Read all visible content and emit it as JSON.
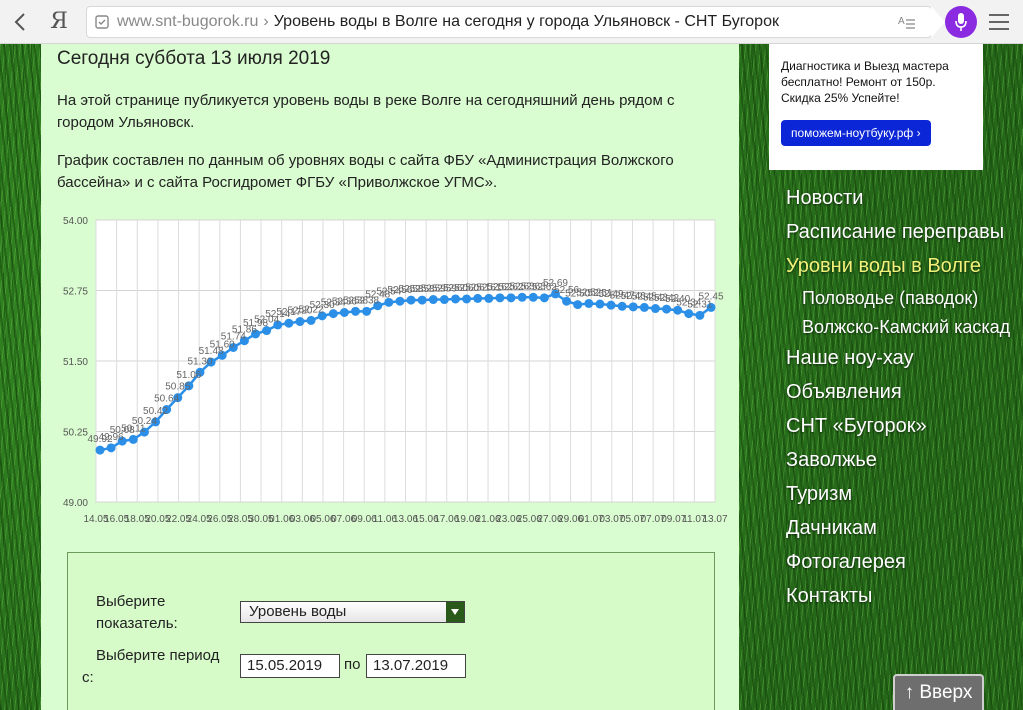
{
  "browser": {
    "domain": "www.snt-bugorok.ru",
    "separator": "›",
    "page_title": "Уровень воды в Волге на сегодня у города Ульяновск - СНТ Бугорок",
    "logo": "Я"
  },
  "main": {
    "date_heading": "Сегодня суббота 13 июля 2019",
    "paragraph1": "На этой странице публикуется уровень воды в реке Волге на сегодняшний день рядом с городом Ульяновск.",
    "paragraph2": "График составлен по данным об уровнях воды с сайта ФБУ «Администрация Волжского бассейна» и с сайта Росгидромет ФГБУ «Приволжское УГМС»."
  },
  "chart_data": {
    "type": "line",
    "title": "",
    "xlabel": "",
    "ylabel": "",
    "ylim": [
      49.0,
      54.0
    ],
    "y_ticks": [
      "49.00",
      "50.25",
      "51.50",
      "52.75",
      "54.00"
    ],
    "x_tick_labels": [
      "14.05",
      "16.05",
      "18.05",
      "20.05",
      "22.05",
      "24.05",
      "26.05",
      "28.05",
      "30.05",
      "01.06",
      "03.06",
      "05.06",
      "07.06",
      "09.06",
      "11.06",
      "13.06",
      "15.06",
      "17.06",
      "19.06",
      "21.06",
      "23.06",
      "25.06",
      "27.06",
      "29.06",
      "01.07",
      "03.07",
      "05.07",
      "07.07",
      "09.07",
      "11.07",
      "13.07"
    ],
    "series_color": "#2b8fe8",
    "grid": true,
    "series": [
      {
        "values": [
          49.92,
          49.96,
          50.08,
          50.11,
          50.24,
          50.42,
          50.64,
          50.85,
          51.06,
          51.3,
          51.48,
          51.6,
          51.74,
          51.86,
          51.98,
          52.04,
          52.14,
          52.17,
          52.2,
          52.22,
          52.3,
          52.34,
          52.36,
          52.38,
          52.38,
          52.48,
          52.54,
          52.56,
          52.58,
          52.58,
          52.59,
          52.59,
          52.6,
          52.6,
          52.61,
          52.61,
          52.62,
          52.62,
          52.63,
          52.63,
          52.62,
          52.69,
          52.56,
          52.5,
          52.52,
          52.51,
          52.49,
          52.47,
          52.46,
          52.45,
          52.43,
          52.42,
          52.4,
          52.34,
          52.31,
          52.45
        ],
        "data_labels": [
          "49.92",
          "49.96",
          "50.08",
          "50.11",
          "50.24",
          "50.42",
          "50.64",
          "50.85",
          "51.06",
          "51.30",
          "51.48",
          "51.60",
          "51.74",
          "51.86",
          "51.98",
          "52.04",
          "52.14",
          "52.17",
          "52.20",
          "52.22",
          "52.30",
          "52.34",
          "52.36",
          "52.38",
          "52.38",
          "52.48",
          "52.54",
          "52.56",
          "52.58",
          "52.58",
          "52.59",
          "52.59",
          "52.60",
          "52.60",
          "52.61",
          "52.61",
          "52.62",
          "52.62",
          "52.63",
          "52.63",
          "52.62",
          "52.69",
          "52.56",
          "52.50",
          "52.52",
          "52.51",
          "52.49",
          "52.47",
          "52.46",
          "52.45",
          "52.43",
          "52.42",
          "52.40",
          "52.34",
          "52.31",
          "52.45"
        ]
      }
    ]
  },
  "form": {
    "indicator_label": "Выберите показатель:",
    "indicator_value": "Уровень воды",
    "period_label": "Выберите период с:",
    "date_from": "15.05.2019",
    "po": "по",
    "date_to": "13.07.2019"
  },
  "ad": {
    "text": "Диагностика и Выезд мастера бесплатно! Ремонт от 150р. Скидка 25% Успейте!",
    "button": "поможем-ноутбуку.рф ›"
  },
  "nav": {
    "items": [
      {
        "label": "Новости"
      },
      {
        "label": "Расписание переправы"
      },
      {
        "label": "Уровни воды в Волге"
      },
      {
        "label": "Половодье (паводок)"
      },
      {
        "label": "Волжско-Камский каскад"
      },
      {
        "label": "Наше ноу-хау"
      },
      {
        "label": "Объявления"
      },
      {
        "label": "СНТ «Бугорок»"
      },
      {
        "label": "Заволжье"
      },
      {
        "label": "Туризм"
      },
      {
        "label": "Дачникам"
      },
      {
        "label": "Фотогалерея"
      },
      {
        "label": "Контакты"
      }
    ]
  },
  "up_button": "↑ Вверх"
}
